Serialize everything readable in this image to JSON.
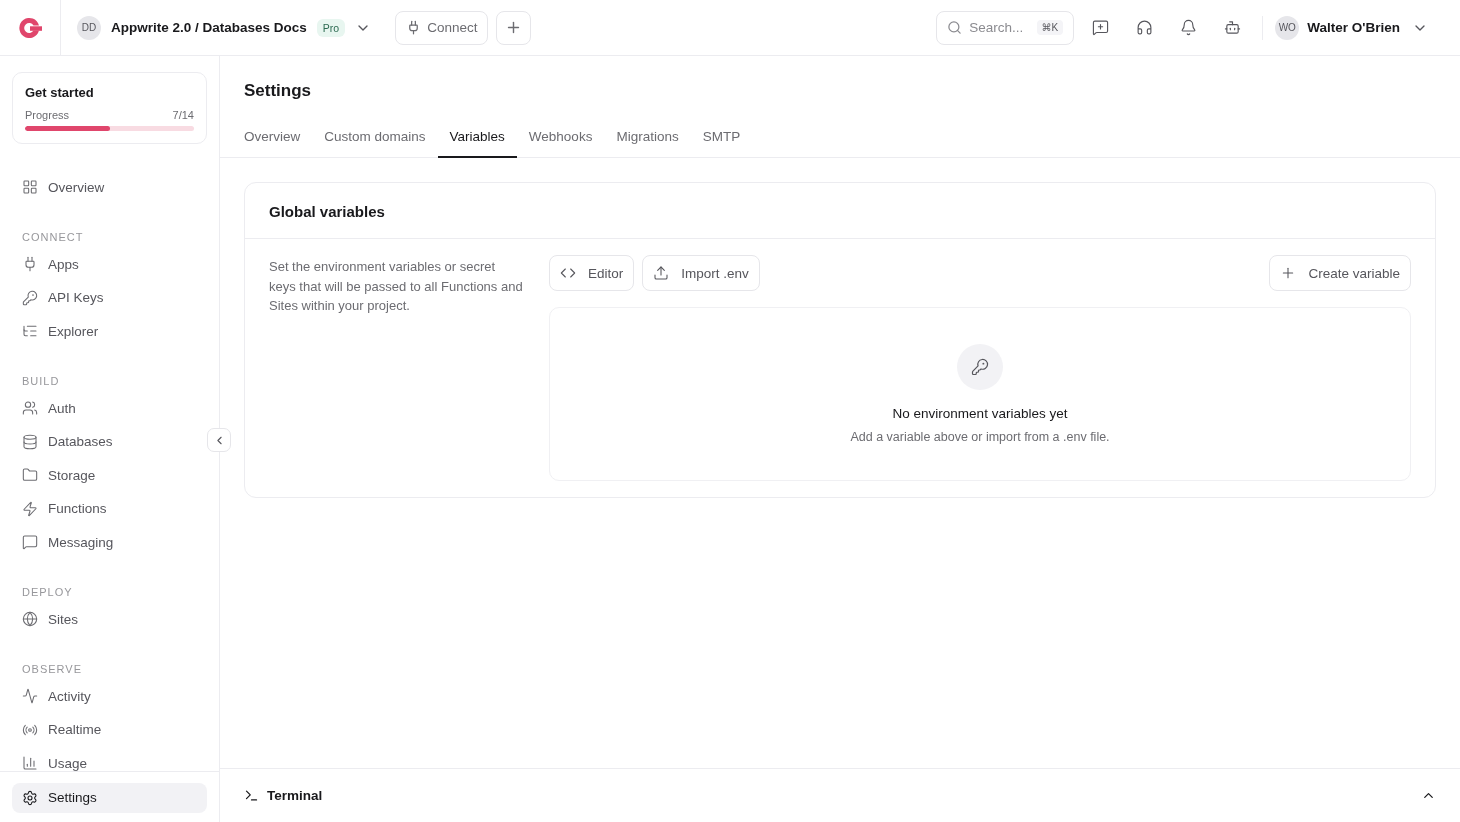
{
  "header": {
    "project_initials": "DD",
    "project_name": "Appwrite 2.0 / Databases Docs",
    "plan_badge": "Pro",
    "connect_button": "Connect",
    "search": {
      "placeholder": "Search...",
      "shortcut": "⌘K"
    },
    "user": {
      "initials": "WO",
      "name": "Walter O'Brien"
    }
  },
  "get_started": {
    "title": "Get started",
    "progress_label": "Progress",
    "progress_count": "7/14",
    "level": 0.5
  },
  "sidebar": {
    "sections": [
      {
        "items": [
          {
            "label": "Overview",
            "selected": false
          }
        ]
      },
      {
        "heading": "CONNECT",
        "items": [
          {
            "label": "Apps",
            "selected": false
          },
          {
            "label": "API Keys",
            "selected": false
          },
          {
            "label": "Explorer",
            "selected": false
          }
        ]
      },
      {
        "heading": "BUILD",
        "items": [
          {
            "label": "Auth",
            "selected": false
          },
          {
            "label": "Databases",
            "selected": false
          },
          {
            "label": "Storage",
            "selected": false
          },
          {
            "label": "Functions",
            "selected": false
          },
          {
            "label": "Messaging",
            "selected": false
          }
        ]
      },
      {
        "heading": "DEPLOY",
        "items": [
          {
            "label": "Sites",
            "selected": false
          }
        ]
      },
      {
        "heading": "OBSERVE",
        "items": [
          {
            "label": "Activity",
            "selected": false
          },
          {
            "label": "Realtime",
            "selected": false
          },
          {
            "label": "Usage",
            "selected": false
          }
        ]
      }
    ],
    "footer_item": {
      "label": "Settings",
      "selected": true
    }
  },
  "page": {
    "title": "Settings",
    "tabs": [
      {
        "label": "Overview",
        "selected": false
      },
      {
        "label": "Custom domains",
        "selected": false
      },
      {
        "label": "Variables",
        "selected": true
      },
      {
        "label": "Webhooks",
        "selected": false
      },
      {
        "label": "Migrations",
        "selected": false
      },
      {
        "label": "SMTP",
        "selected": false
      }
    ]
  },
  "card": {
    "title": "Global variables",
    "description": "Set the environment variables or secret keys that will be passed to all Functions and Sites within your project.",
    "buttons": [
      {
        "label": "Editor"
      },
      {
        "label": "Import .env"
      }
    ],
    "create_button": "Create variable",
    "empty": {
      "title": "No environment variables yet",
      "subtitle": "Add a variable above or import from a .env file."
    }
  },
  "terminal": {
    "label": "Terminal"
  }
}
